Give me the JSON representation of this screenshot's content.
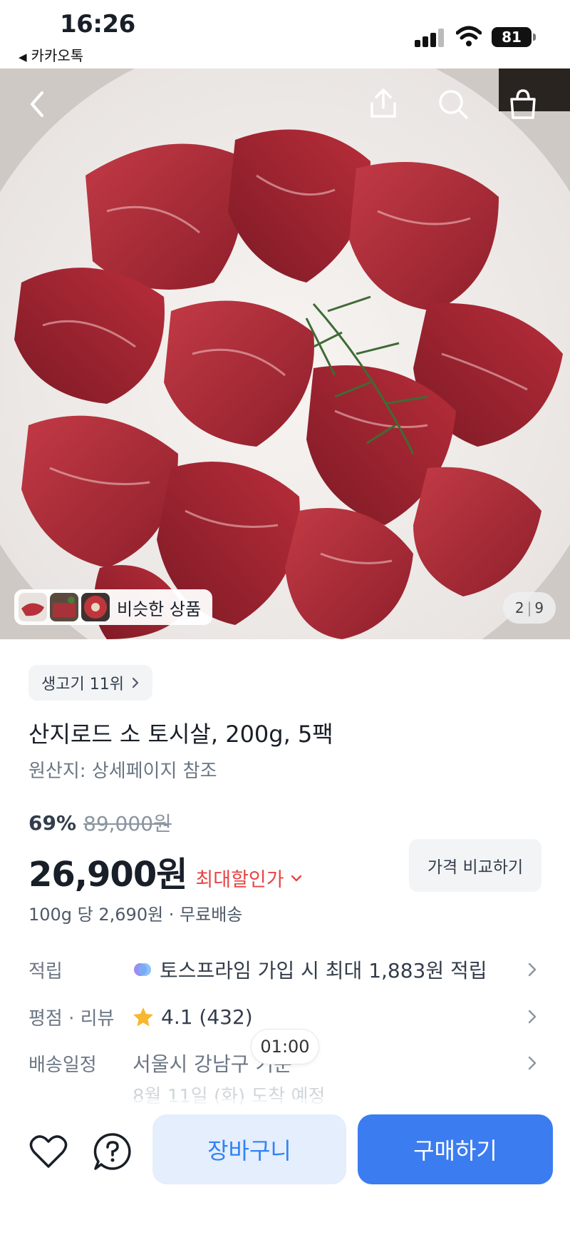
{
  "status_bar": {
    "time": "16:26",
    "back_app": "카카오톡",
    "battery": "81"
  },
  "hero": {
    "similar_label": "비슷한 상품",
    "page_current": "2",
    "page_total": "9",
    "icons": [
      "back-icon",
      "share-icon",
      "search-icon",
      "shopping-bag-icon"
    ]
  },
  "product": {
    "rank_chip": "생고기 11위",
    "title": "산지로드 소 토시살, 200g, 5팩",
    "origin": "원산지: 상세페이지 참조",
    "discount_rate": "69%",
    "original_price": "89,000원",
    "price": "26,900원",
    "max_discount_label": "최대할인가",
    "compare_label": "가격 비교하기",
    "unit_price": "100g 당 2,690원 · 무료배송"
  },
  "info": {
    "points_label": "적립",
    "points_value": "토스프라임 가입 시 최대 1,883원 적립",
    "rating_label": "평점 · 리뷰",
    "rating_value": "4.1 (432)",
    "delivery_label": "배송일정",
    "delivery_value": "서울시 강남구 기준",
    "delivery_date": "8월 11일 (화) 도착 예정",
    "timer": "01:00"
  },
  "bottom": {
    "cart_label": "장바구니",
    "buy_label": "구매하기"
  },
  "colors": {
    "accent_blue": "#3b7cf0",
    "cart_bg": "#e4eefc",
    "discount_red": "#e84545",
    "star_yellow": "#f7b730"
  }
}
